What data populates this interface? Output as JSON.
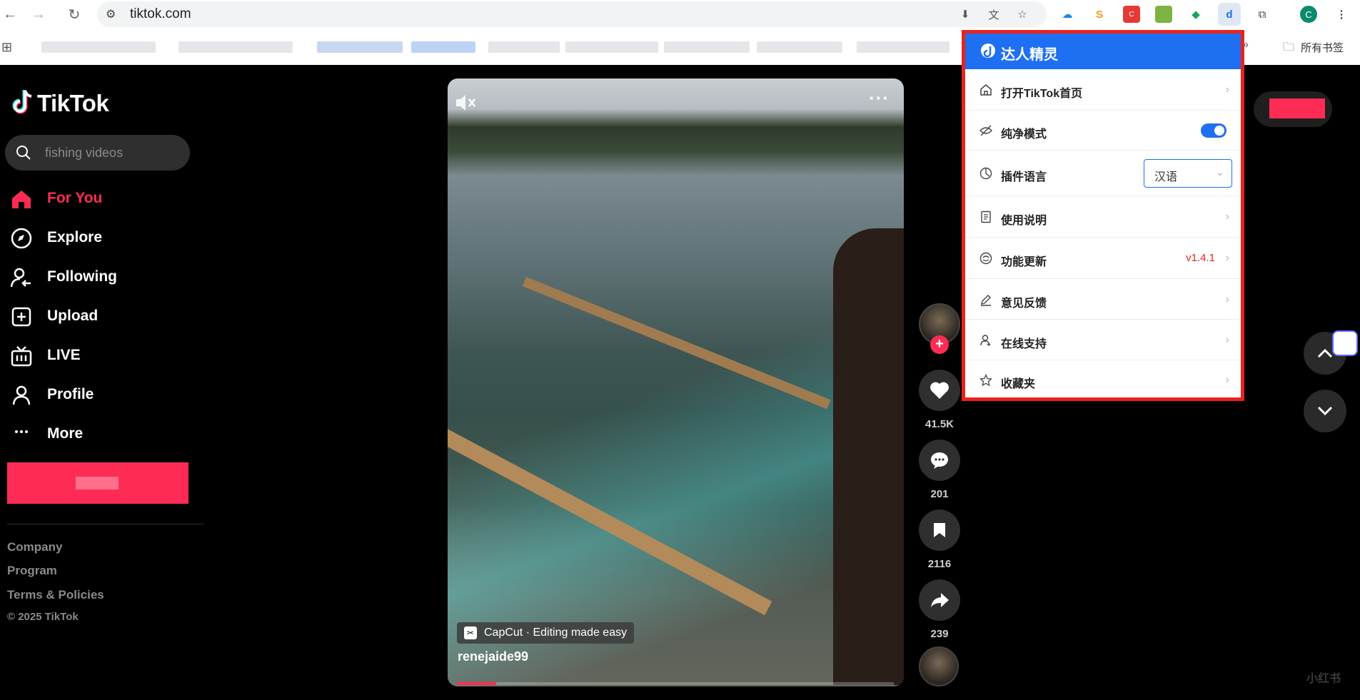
{
  "browser": {
    "url": "tiktok.com",
    "bookmarks_all_label": "所有书签",
    "profile_initial": "C"
  },
  "sidebar": {
    "logo": "TikTok",
    "search_placeholder": "fishing videos",
    "items": [
      {
        "label": "For You",
        "icon": "home-icon",
        "active": true
      },
      {
        "label": "Explore",
        "icon": "compass-icon"
      },
      {
        "label": "Following",
        "icon": "following-icon"
      },
      {
        "label": "Upload",
        "icon": "upload-icon"
      },
      {
        "label": "LIVE",
        "icon": "live-tv-icon"
      },
      {
        "label": "Profile",
        "icon": "profile-icon"
      },
      {
        "label": "More",
        "icon": "more-dots-icon"
      }
    ],
    "footer": [
      "Company",
      "Program",
      "Terms & Policies"
    ],
    "copyright": "© 2025 TikTok"
  },
  "video": {
    "capcut_label": "CapCut · Editing made easy",
    "author": "renejaide99",
    "progress": 0.09
  },
  "actions": {
    "likes": "41.5K",
    "comments": "201",
    "saves": "2116",
    "shares": "239"
  },
  "popup": {
    "title": "达人精灵",
    "items": [
      {
        "label": "打开TikTok首页",
        "icon": "home-outline-icon"
      },
      {
        "label": "纯净模式",
        "icon": "eye-off-icon",
        "toggle": true
      },
      {
        "label": "插件语言",
        "icon": "language-icon",
        "select_value": "汉语"
      },
      {
        "label": "使用说明",
        "icon": "document-icon"
      },
      {
        "label": "功能更新",
        "icon": "update-icon",
        "version": "v1.4.1"
      },
      {
        "label": "意见反馈",
        "icon": "edit-icon"
      },
      {
        "label": "在线支持",
        "icon": "support-user-icon"
      },
      {
        "label": "收藏夹",
        "icon": "star-icon"
      }
    ]
  },
  "colors": {
    "accent": "#fe2c55",
    "popup_blue": "#1e6ff1",
    "popup_border": "#e8231d"
  },
  "watermark": "小红书"
}
